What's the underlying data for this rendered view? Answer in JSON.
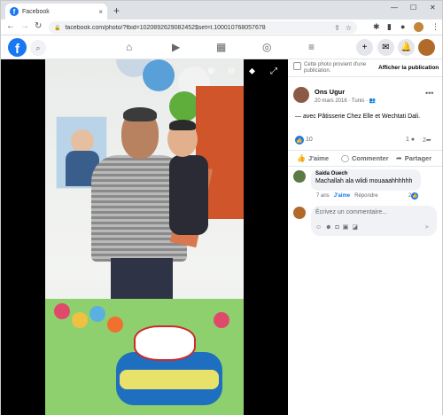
{
  "browser": {
    "tab_title": "Facebook",
    "tab_close": "×",
    "new_tab": "+",
    "win_minimize": "—",
    "win_maximize": "☐",
    "win_close": "✕",
    "url": "facebook.com/photo/?fbid=1020892629082452$set=t.100010768057678"
  },
  "fb_nav": {
    "logo": "f",
    "icons": [
      "search-icon",
      "home-icon",
      "video-icon",
      "marketplace-icon",
      "groups-icon",
      "menu-icon"
    ],
    "right_icons": [
      "plus-icon",
      "messenger-icon",
      "bell-icon"
    ]
  },
  "side": {
    "source_text": "Cette photo provient d'une publication.",
    "source_button": "Afficher la publication",
    "post": {
      "author": "Ons Ugur",
      "meta": "20 mars 2016 · Tunis · ",
      "text": "— avec Pâtisserie Chez Elle et Wechtati Dali."
    },
    "reactions": {
      "likes": "10",
      "comments": "1",
      "shares": "2"
    },
    "actions": {
      "like": "J'aime",
      "comment": "Commenter",
      "share": "Partager"
    },
    "comment": {
      "name": "Saida Ouech",
      "text": "Machallah ala wlidi mouaaahhhhhh",
      "age": "7 ans",
      "like_link": "J'aime",
      "reply_link": "Répondre",
      "like_count": "2"
    },
    "write_placeholder": "Écrivez un commentaire..."
  },
  "colors": {
    "fb_blue": "#1877f2",
    "panel_bg": "#f0f2f5",
    "text_secondary": "#65676b"
  }
}
